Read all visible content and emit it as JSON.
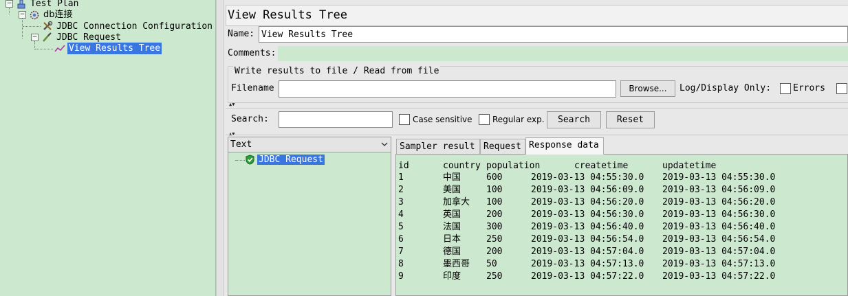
{
  "tree": {
    "nodes": [
      {
        "label": "Test Plan",
        "icon": "test-plan-icon"
      },
      {
        "label": "db连接",
        "icon": "thread-group-gear-icon"
      },
      {
        "label": "JDBC Connection Configuration",
        "icon": "config-wrench-icon"
      },
      {
        "label": "JDBC Request",
        "icon": "sampler-pipette-icon"
      },
      {
        "label": "View Results Tree",
        "icon": "listener-graph-icon",
        "selected": true
      }
    ]
  },
  "panel": {
    "title": "View Results Tree",
    "name_label": "Name:",
    "name_value": "View Results Tree",
    "comments_label": "Comments:",
    "comments_value": ""
  },
  "file_group": {
    "title": "Write results to file / Read from file",
    "filename_label": "Filename",
    "filename_value": "",
    "browse_label": "Browse...",
    "log_display_label": "Log/Display Only:",
    "errors_label": "Errors",
    "errors_checked": false
  },
  "search": {
    "label": "Search:",
    "value": "",
    "case_sensitive_label": "Case sensitive",
    "regexp_label": "Regular exp.",
    "search_button": "Search",
    "reset_button": "Reset"
  },
  "results_tree": {
    "renderer": "Text",
    "samples": [
      {
        "label": "JDBC Request",
        "status": "success"
      }
    ]
  },
  "tabs": [
    {
      "label": "Sampler result",
      "active": false
    },
    {
      "label": "Request",
      "active": false
    },
    {
      "label": "Response data",
      "active": true
    }
  ],
  "response": {
    "headers": [
      "id",
      "country",
      "population",
      "createtime",
      "updatetime"
    ],
    "rows": [
      [
        "1",
        "中国",
        "600",
        "2019-03-13 04:55:30.0",
        "2019-03-13 04:55:30.0"
      ],
      [
        "2",
        "美国",
        "100",
        "2019-03-13 04:56:09.0",
        "2019-03-13 04:56:09.0"
      ],
      [
        "3",
        "加拿大",
        "100",
        "2019-03-13 04:56:20.0",
        "2019-03-13 04:56:20.0"
      ],
      [
        "4",
        "英国",
        "200",
        "2019-03-13 04:56:30.0",
        "2019-03-13 04:56:30.0"
      ],
      [
        "5",
        "法国",
        "300",
        "2019-03-13 04:56:40.0",
        "2019-03-13 04:56:40.0"
      ],
      [
        "6",
        "日本",
        "250",
        "2019-03-13 04:56:54.0",
        "2019-03-13 04:56:54.0"
      ],
      [
        "7",
        "德国",
        "200",
        "2019-03-13 04:57:04.0",
        "2019-03-13 04:57:04.0"
      ],
      [
        "8",
        "墨西哥",
        "50",
        "2019-03-13 04:57:13.0",
        "2019-03-13 04:57:13.0"
      ],
      [
        "9",
        "印度",
        "250",
        "2019-03-13 04:57:22.0",
        "2019-03-13 04:57:22.0"
      ]
    ]
  },
  "colors": {
    "tree_background": "#cce8cf",
    "selection": "#3a76e0",
    "success": "#2e9a3a"
  }
}
